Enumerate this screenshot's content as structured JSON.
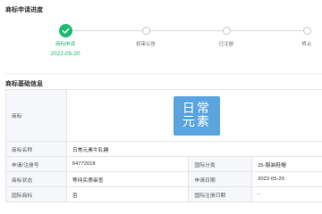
{
  "progress": {
    "title": "商标申请进度",
    "steps": [
      {
        "label": "商标申请",
        "date": "2022-05-20",
        "done": true
      },
      {
        "label": "初审公告"
      },
      {
        "label": "已注册"
      },
      {
        "label": "终止"
      }
    ]
  },
  "basic": {
    "title": "商标基础信息",
    "trademark_label": "商标",
    "logo_text": "日常元素",
    "name_label": "商标名称",
    "name_value": "日常元素牛轧糖",
    "reg_no_label": "申请/注册号",
    "reg_no_value": "64772018",
    "class_label": "国际分类",
    "class_value": "25-服装鞋帽",
    "status_label": "商标状态",
    "status_value": "等待实质审查",
    "apply_date_label": "申请日期",
    "apply_date_value": "2022-05-20",
    "intl_label": "国际商标",
    "intl_value": "否",
    "intl_reg_date_label": "国际注册日期",
    "intl_reg_date_value": "-"
  },
  "colors": {
    "accent": "#1cbd72",
    "logo_bg": "#5aa5df"
  }
}
